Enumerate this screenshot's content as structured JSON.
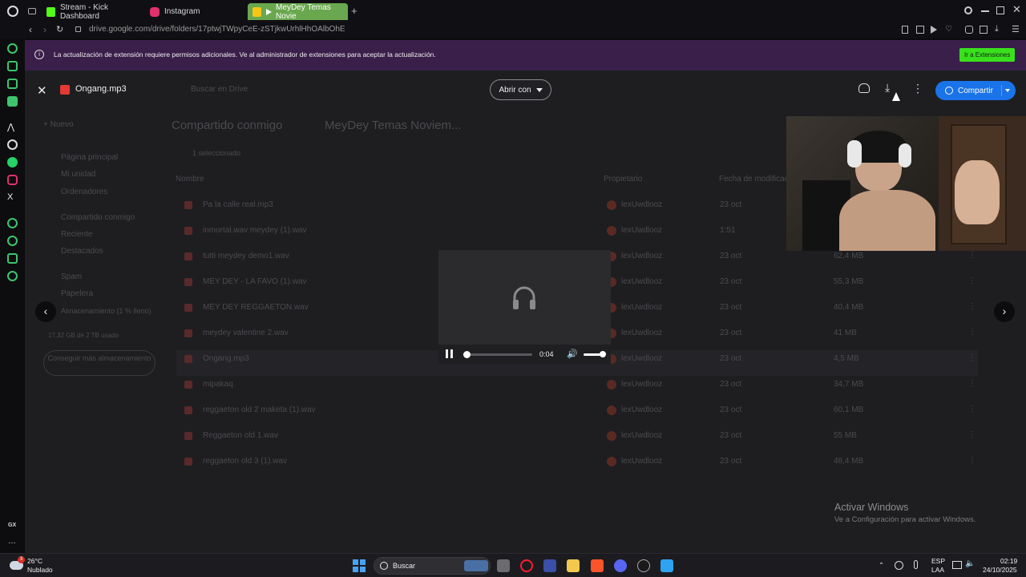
{
  "browser": {
    "tabs": [
      {
        "label": "Stream - Kick Dashboard",
        "color": "#53fc18"
      },
      {
        "label": "Instagram",
        "color": "#e1306c"
      },
      {
        "label": "MeyDey Temas Novie",
        "color": "#1a73e8"
      }
    ],
    "new_tab": "+",
    "url": "drive.google.com/drive/folders/17ptwjTWpyCeE-zSTjkwUrhlHhOAlbOhE"
  },
  "notification": {
    "text": "La actualización de extensión requiere permisos adicionales. Ve al administrador de extensiones para aceptar la actualización.",
    "button": "Ir a Extensiones"
  },
  "drive": {
    "new_button": "Nuevo",
    "search_placeholder": "Buscar en Drive",
    "breadcrumb": [
      "Compartido conmigo",
      "MeyDey Temas Noviem..."
    ],
    "sidebar": [
      "Página principal",
      "Mi unidad",
      "Ordenadores",
      "Compartido conmigo",
      "Reciente",
      "Destacados",
      "Spam",
      "Papelera",
      "Almacenamiento (1 % lleno)"
    ],
    "storage_text": "17,32 GB de 2 TB usado",
    "storage_button": "Conseguir más almacenamiento",
    "selected_text": "1 seleccionado",
    "columns": [
      "Nombre",
      "Propietario",
      "Fecha de modificación"
    ],
    "files": [
      {
        "name": "Pa la calle real.mp3",
        "owner": "lexUwdlooz",
        "date": "23 oct",
        "size": ""
      },
      {
        "name": "inmortal.wav meydey (1).wav",
        "owner": "lexUwdlooz",
        "date": "1:51",
        "size": ""
      },
      {
        "name": "tutti meydey demo1.wav",
        "owner": "lexUwdlooz",
        "date": "23 oct",
        "size": "62,4 MB"
      },
      {
        "name": "MEY DEY - LA FAVO (1).wav",
        "owner": "lexUwdlooz",
        "date": "23 oct",
        "size": "55,3 MB"
      },
      {
        "name": "MEY DEY REGGAETON.wav",
        "owner": "lexUwdlooz",
        "date": "23 oct",
        "size": "40,4 MB"
      },
      {
        "name": "meydey valentine 2.wav",
        "owner": "lexUwdlooz",
        "date": "23 oct",
        "size": "41 MB"
      },
      {
        "name": "Ongang.mp3",
        "owner": "lexUwdlooz",
        "date": "23 oct",
        "size": "4,5 MB"
      },
      {
        "name": "mipakaq",
        "owner": "lexUwdlooz",
        "date": "23 oct",
        "size": "34,7 MB"
      },
      {
        "name": "reggaeton old 2 maketa (1).wav",
        "owner": "lexUwdlooz",
        "date": "23 oct",
        "size": "60,1 MB"
      },
      {
        "name": "Reggaeton old 1.wav",
        "owner": "lexUwdlooz",
        "date": "23 oct",
        "size": "55 MB"
      },
      {
        "name": "reggaeton old 3 (1).wav",
        "owner": "lexUwdlooz",
        "date": "23 oct",
        "size": "48,4 MB"
      }
    ]
  },
  "viewer": {
    "file_name": "Ongang.mp3",
    "open_with": "Abrir con",
    "share": "Compartir",
    "player": {
      "time": "0:04",
      "progress_fraction": 0.05,
      "volume_fraction": 1.0
    }
  },
  "watermark": {
    "title": "Activar Windows",
    "subtitle": "Ve a Configuración para activar Windows."
  },
  "taskbar": {
    "weather_temp": "26°C",
    "weather_desc": "Nublado",
    "weather_badge": "3",
    "search_placeholder": "Buscar",
    "lang": "ESP",
    "lang2": "LAA",
    "time": "02:19",
    "date": "24/10/2025",
    "gx_label": "GX"
  }
}
